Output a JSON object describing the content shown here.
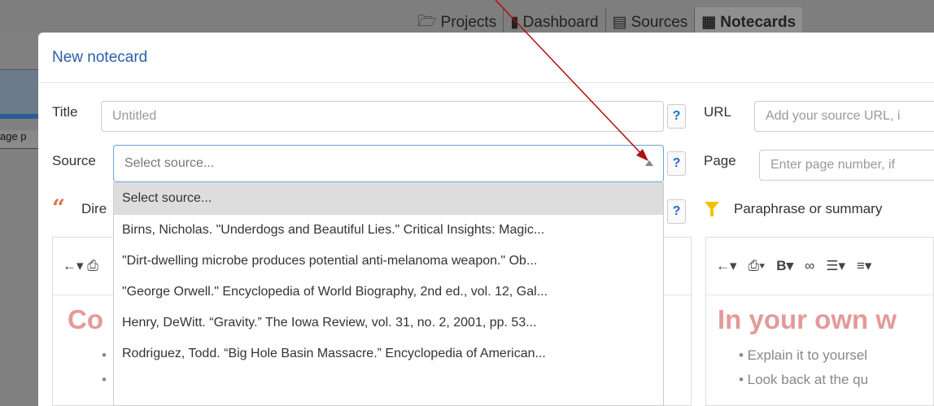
{
  "background": {
    "tabs": [
      {
        "icon": "folder-icon",
        "label": "Projects"
      },
      {
        "icon": "bar-chart-icon",
        "label": "Dashboard"
      },
      {
        "icon": "list-icon",
        "label": "Sources"
      },
      {
        "icon": "grid-icon",
        "label": "Notecards"
      }
    ],
    "left_label": "age p"
  },
  "modal": {
    "title": "New notecard",
    "title_label": "Title",
    "title_placeholder": "Untitled",
    "url_label": "URL",
    "url_placeholder": "Add your source URL, i",
    "source_label": "Source",
    "source_placeholder": "Select source...",
    "page_label": "Page",
    "page_placeholder": "Enter page number, if",
    "help_glyph": "?",
    "direct_quote_label": "Dire",
    "paraphrase_label": "Paraphrase or summary"
  },
  "dropdown": {
    "options": [
      "Select source...",
      "Birns, Nicholas. \"Underdogs and Beautiful Lies.\" Critical Insights: Magic...",
      "\"Dirt-dwelling microbe produces potential anti-melanoma weapon.\" Ob...",
      "\"George Orwell.\" Encyclopedia of World Biography, 2nd ed., vol. 12, Gal...",
      "Henry, DeWitt. “Gravity.” The Iowa Review, vol. 31, no. 2, 2001, pp.    53...",
      "Rodriguez, Todd. “Big Hole Basin Massacre.” Encyclopedia of American..."
    ]
  },
  "left_editor": {
    "toolbar": "←▾  ⎙",
    "heading": "Co",
    "bullets": [
      "•",
      "•"
    ]
  },
  "right_editor": {
    "toolbar_items": [
      "←▾",
      "⎙▾",
      "B▾",
      "∞",
      "☰▾",
      "≡▾"
    ],
    "heading": "In your own w",
    "bullets": [
      "•  Explain it to yoursel",
      "•  Look back at the qu"
    ]
  },
  "colors": {
    "accent": "#2a5fa8",
    "quote": "#e2704e",
    "paraphrase": "#f2c200",
    "arrow": "#b01010"
  }
}
